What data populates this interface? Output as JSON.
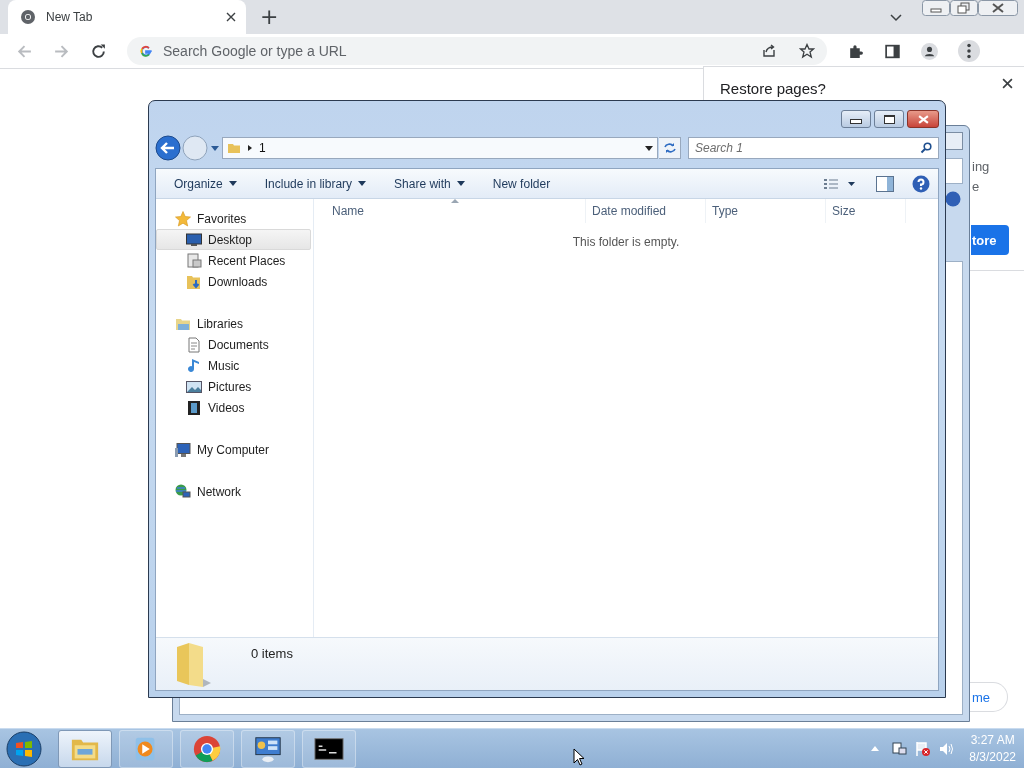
{
  "browser": {
    "tab": {
      "title": "New Tab",
      "selected": true
    },
    "new_tab": "+",
    "address": {
      "placeholder": "Search Google or type a URL"
    }
  },
  "restore_popup": {
    "title": "Restore pages?",
    "fragments": [
      "ing",
      "e"
    ],
    "button": "tore"
  },
  "home_pill": {
    "label": "me"
  },
  "explorer": {
    "path": "1",
    "search": {
      "placeholder": "Search 1"
    },
    "commands": [
      {
        "label": "Organize",
        "dropdown": true
      },
      {
        "label": "Include in library",
        "dropdown": true
      },
      {
        "label": "Share with",
        "dropdown": true
      },
      {
        "label": "New folder",
        "dropdown": false
      }
    ],
    "nav": [
      {
        "label": "Favorites",
        "kind": "star",
        "selected": false,
        "children": [
          {
            "label": "Desktop",
            "kind": "desktop",
            "selected": true
          },
          {
            "label": "Recent Places",
            "kind": "recent",
            "selected": false
          },
          {
            "label": "Downloads",
            "kind": "downloads",
            "selected": false
          }
        ]
      },
      {
        "label": "Libraries",
        "kind": "libraries",
        "selected": false,
        "children": [
          {
            "label": "Documents",
            "kind": "documents",
            "selected": false
          },
          {
            "label": "Music",
            "kind": "music",
            "selected": false
          },
          {
            "label": "Pictures",
            "kind": "pictures",
            "selected": false
          },
          {
            "label": "Videos",
            "kind": "videos",
            "selected": false
          }
        ]
      },
      {
        "label": "My Computer",
        "kind": "computer",
        "selected": false
      },
      {
        "label": "Network",
        "kind": "network",
        "selected": false
      }
    ],
    "columns": [
      "Name",
      "Date modified",
      "Type",
      "Size"
    ],
    "empty_message": "This folder is empty.",
    "status": "0 items"
  },
  "taskbar": {
    "apps": [
      {
        "kind": "folder",
        "selected": true
      },
      {
        "kind": "media",
        "selected": false
      },
      {
        "kind": "chrome",
        "selected": false
      },
      {
        "kind": "panel",
        "selected": false
      },
      {
        "kind": "console",
        "selected": false
      }
    ],
    "clock": {
      "time": "3:27 AM",
      "date": "8/3/2022"
    }
  }
}
